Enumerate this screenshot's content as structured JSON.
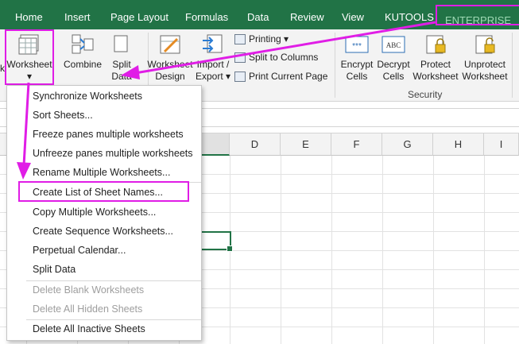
{
  "tabs": [
    "Home",
    "Insert",
    "Page Layout",
    "Formulas",
    "Data",
    "Review",
    "View",
    "KUTOOLS",
    "ENTERPRISE"
  ],
  "ribbon": {
    "left_cut_letter": "k",
    "worksheet": "Worksheet",
    "combine": "Combine",
    "split_data_top": "Split",
    "split_data_bottom": "Data",
    "worksheet_design_top": "Worksheet",
    "worksheet_design_bottom": "Design",
    "import_export_top": "Import /",
    "import_export_bottom": "Export",
    "printing": "Printing",
    "split_to_columns": "Split to Columns",
    "print_current_page": "Print Current Page",
    "encrypt_top": "Encrypt",
    "encrypt_bottom": "Cells",
    "decrypt_top": "Decrypt",
    "decrypt_bottom": "Cells",
    "protect_top": "Protect",
    "protect_bottom": "Worksheet",
    "unprotect_top": "Unprotect",
    "unprotect_bottom": "Worksheet",
    "security_group": "Security",
    "icon_text_encrypt": "***",
    "icon_text_decrypt": "ABC"
  },
  "columns": [
    "D",
    "E",
    "F",
    "G",
    "H",
    "I"
  ],
  "menu": {
    "items": [
      "Synchronize Worksheets",
      "Sort Sheets...",
      "Freeze panes multiple worksheets",
      "Unfreeze panes multiple worksheets",
      "Rename Multiple Worksheets...",
      "Create List of Sheet Names...",
      "Copy Multiple Worksheets...",
      "Create Sequence Worksheets...",
      "Perpetual Calendar...",
      "Split Data"
    ],
    "disabled_items": [
      "Delete Blank Worksheets",
      "Delete All Hidden Sheets"
    ],
    "last_item": "Delete All Inactive Sheets"
  },
  "colors": {
    "excel_green": "#217346",
    "highlight": "#e01de6"
  }
}
